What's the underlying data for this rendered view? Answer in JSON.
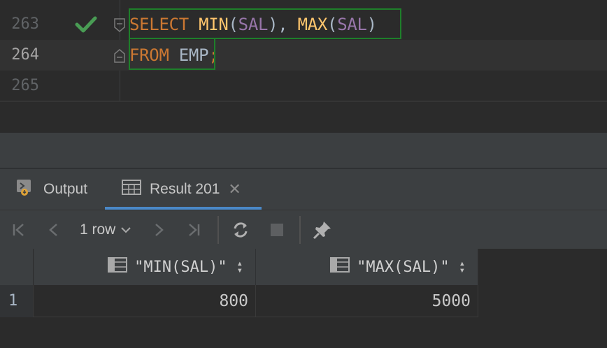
{
  "editor": {
    "lines": [
      {
        "number": "263",
        "tokens": {
          "kw1": "SELECT",
          "fn1": "MIN",
          "p1": "(",
          "c1": "SAL",
          "p2": "), ",
          "fn2": "MAX",
          "p3": "(",
          "c2": "SAL",
          "p4": ")"
        }
      },
      {
        "number": "264",
        "tokens": {
          "kw1": "FROM",
          "sp": " ",
          "tbl": "EMP",
          "semi": ";"
        }
      },
      {
        "number": "265"
      }
    ],
    "execution_status_icon": "checkmark-icon",
    "colors": {
      "keyword": "#cc7832",
      "function": "#ffc66d",
      "column": "#9876aa",
      "plain": "#a9b7c6",
      "highlight_border": "#1e7f2a"
    }
  },
  "tabs": {
    "output_label": "Output",
    "result_label": "Result 201",
    "close_glyph": "✕"
  },
  "toolbar": {
    "row_count": "1 row",
    "buttons": [
      "first-page-icon",
      "previous-page-icon",
      "next-page-icon",
      "last-page-icon",
      "refresh-icon",
      "stop-icon",
      "pin-icon"
    ]
  },
  "grid": {
    "columns": [
      "\"MIN(SAL)\"",
      "\"MAX(SAL)\""
    ],
    "rows": [
      {
        "row_number": "1",
        "cells": [
          "800",
          "5000"
        ]
      }
    ]
  }
}
